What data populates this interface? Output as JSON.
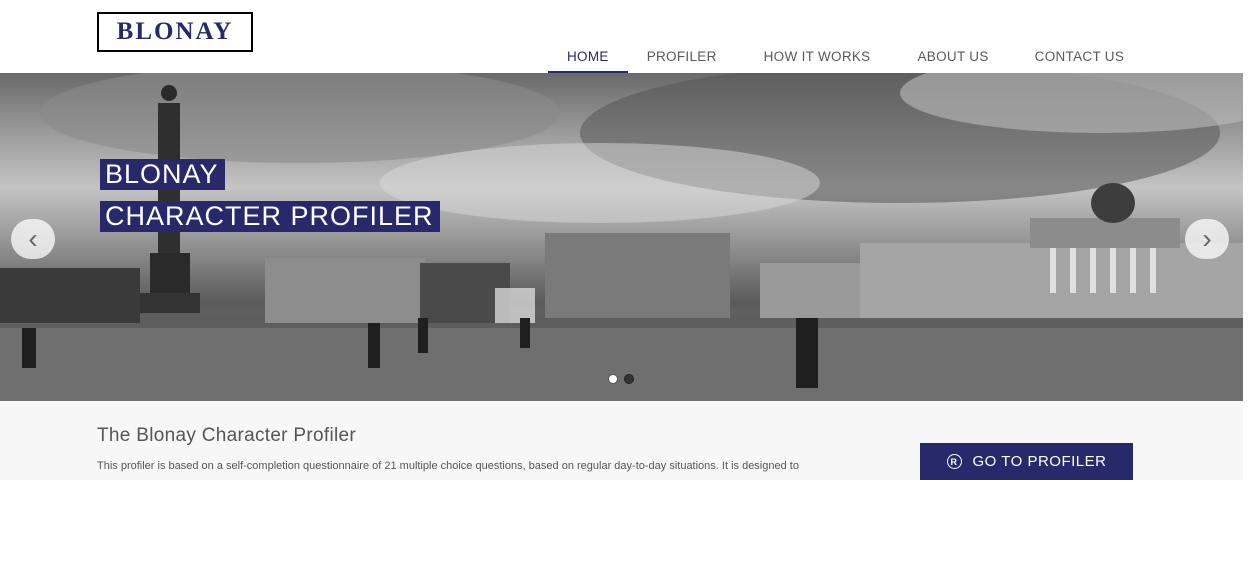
{
  "brand": {
    "logo_text": "BLONAY"
  },
  "nav": {
    "items": [
      {
        "label": "HOME",
        "active": true
      },
      {
        "label": "PROFILER",
        "active": false
      },
      {
        "label": "HOW IT WORKS",
        "active": false
      },
      {
        "label": "ABOUT US",
        "active": false
      },
      {
        "label": "CONTACT US",
        "active": false
      }
    ]
  },
  "hero": {
    "title_line1": "BLONAY",
    "title_line2": "CHARACTER PROFILER",
    "prev_icon": "chevron-left-icon",
    "next_icon": "chevron-right-icon",
    "slide_count": 2,
    "active_slide": 1
  },
  "intro": {
    "heading": "The Blonay Character Profiler",
    "text": "This profiler is based on a self-completion questionnaire of 21 multiple choice questions, based on regular day-to-day situations. It is designed to",
    "cta_label": "GO TO PROFILER",
    "cta_icon": "registered-icon"
  },
  "colors": {
    "brand_navy": "#27296b",
    "nav_text": "#5a5a5a",
    "content_bg": "#f7f7f7"
  }
}
